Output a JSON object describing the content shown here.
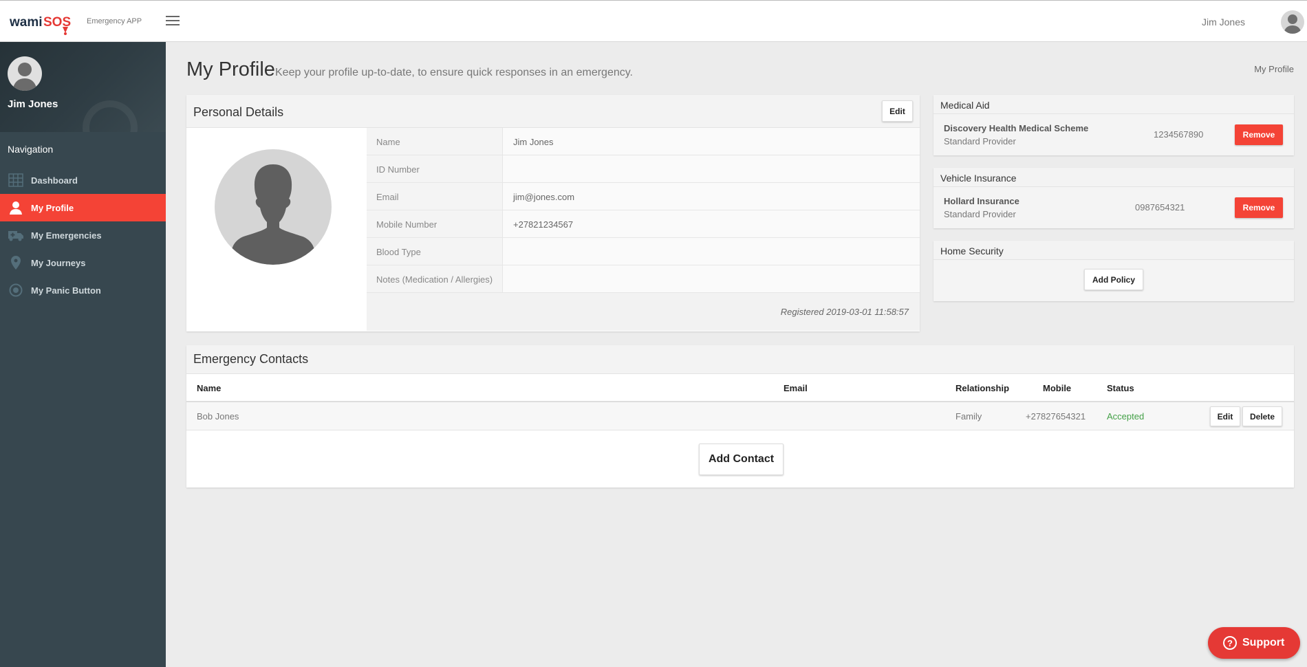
{
  "header": {
    "logo_text": "wamiSOS",
    "app_subtitle": "Emergency APP",
    "user_name": "Jim Jones"
  },
  "sidebar": {
    "user_name": "Jim Jones",
    "nav_title": "Navigation",
    "items": [
      {
        "label": "Dashboard",
        "icon": "grid-icon"
      },
      {
        "label": "My Profile",
        "icon": "user-icon",
        "active": true
      },
      {
        "label": "My Emergencies",
        "icon": "ambulance-icon"
      },
      {
        "label": "My Journeys",
        "icon": "map-pin-icon"
      },
      {
        "label": "My Panic Button",
        "icon": "target-icon"
      }
    ]
  },
  "page": {
    "title": "My Profile",
    "subtitle": "Keep your profile up-to-date, to ensure quick responses in an emergency.",
    "breadcrumb": "My Profile"
  },
  "personal_details": {
    "title": "Personal Details",
    "edit_label": "Edit",
    "rows": [
      {
        "label": "Name",
        "value": "Jim Jones"
      },
      {
        "label": "ID Number",
        "value": ""
      },
      {
        "label": "Email",
        "value": "jim@jones.com"
      },
      {
        "label": "Mobile Number",
        "value": "+27821234567"
      },
      {
        "label": "Blood Type",
        "value": ""
      },
      {
        "label": "Notes (Medication / Allergies)",
        "value": ""
      }
    ],
    "registered": "Registered 2019-03-01 11:58:57"
  },
  "medical_aid": {
    "title": "Medical Aid",
    "name": "Discovery Health Medical Scheme",
    "provider": "Standard Provider",
    "number": "1234567890",
    "remove_label": "Remove"
  },
  "vehicle_insurance": {
    "title": "Vehicle Insurance",
    "name": "Hollard Insurance",
    "provider": "Standard Provider",
    "number": "0987654321",
    "remove_label": "Remove"
  },
  "home_security": {
    "title": "Home Security",
    "add_label": "Add Policy"
  },
  "emergency_contacts": {
    "title": "Emergency Contacts",
    "columns": {
      "name": "Name",
      "email": "Email",
      "relationship": "Relationship",
      "mobile": "Mobile",
      "status": "Status"
    },
    "rows": [
      {
        "name": "Bob Jones",
        "email": "",
        "relationship": "Family",
        "mobile": "+27827654321",
        "status": "Accepted"
      }
    ],
    "edit_label": "Edit",
    "delete_label": "Delete",
    "add_label": "Add Contact"
  },
  "support": {
    "label": "Support"
  },
  "colors": {
    "accent": "#f44336",
    "sidebar": "#37474f",
    "accepted": "#43a047"
  }
}
